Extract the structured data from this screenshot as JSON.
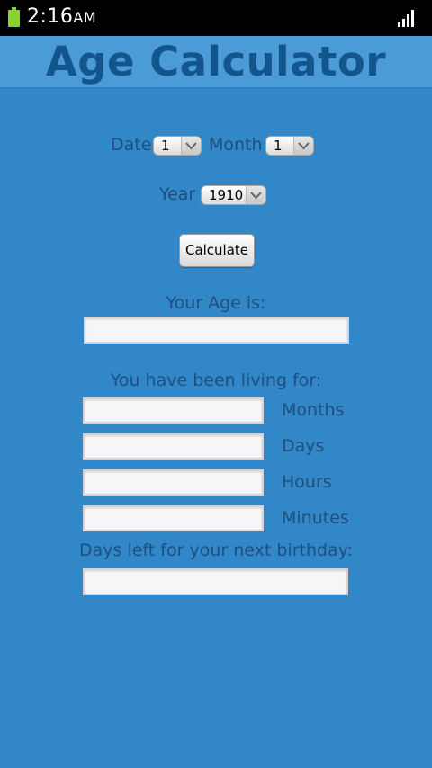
{
  "status_bar": {
    "time": "2:16",
    "ampm": "AM",
    "battery_color": "#8ad32d"
  },
  "app": {
    "title": "Age Calculator",
    "background": "#3187c8",
    "title_bar_color": "#4a9bd6"
  },
  "form": {
    "date_label": "Date",
    "date_value": "1",
    "month_label": "Month",
    "month_value": "1",
    "year_label": "Year",
    "year_value": "1910",
    "calculate_label": "Calculate"
  },
  "results": {
    "age_label": "Your Age is:",
    "age_value": "",
    "living_label": "You have been living for:",
    "months_label": "Months",
    "months_value": "",
    "days_label": "Days",
    "days_value": "",
    "hours_label": "Hours",
    "hours_value": "",
    "minutes_label": "Minutes",
    "minutes_value": "",
    "birthday_label": "Days left for your next birthday:",
    "birthday_value": ""
  }
}
